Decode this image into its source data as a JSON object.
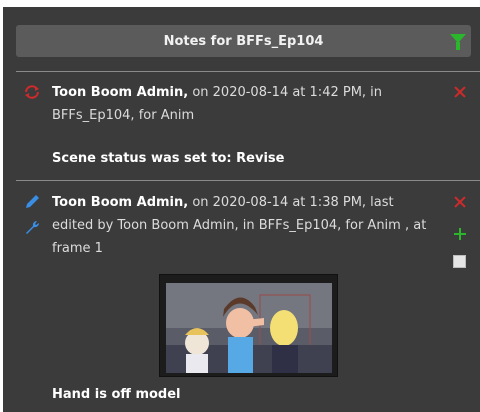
{
  "panel": {
    "title": "Notes for BFFs_Ep104"
  },
  "notes": [
    {
      "author": "Toon Boom Admin,",
      "line1_rest": " on 2020-08-14 at 1:42 PM, in",
      "line2": "BFFs_Ep104, for Anim",
      "body": "Scene status was set to: Revise"
    },
    {
      "author": "Toon Boom Admin,",
      "line1_rest": " on 2020-08-14 at 1:38 PM, last",
      "line2": "edited by Toon Boom Admin, in BFFs_Ep104, for Anim , at",
      "line3": "frame 1",
      "body": "Hand is off model"
    }
  ],
  "colors": {
    "panel_bg": "#3b3b3b",
    "header_bg": "#5b5b5b",
    "delete": "#d12a2a",
    "add": "#2bb72b",
    "pencil": "#3a8ee6"
  },
  "icons": [
    "filter-icon",
    "status-change-icon",
    "delete-icon",
    "pencil-icon",
    "wrench-icon",
    "add-icon",
    "checkbox"
  ]
}
